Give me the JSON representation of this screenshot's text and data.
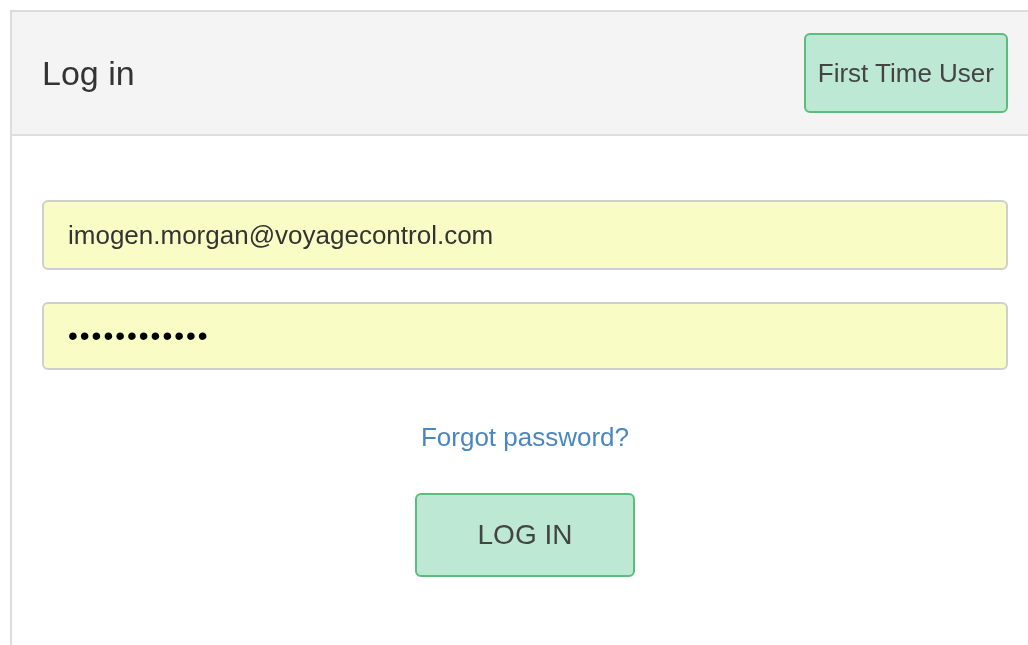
{
  "header": {
    "title": "Log in",
    "first_time_button": "First Time User"
  },
  "email_field": {
    "value": "imogen.morgan@voyagecontrol.com"
  },
  "password_field": {
    "value": "••••••••••••"
  },
  "forgot_link": "Forgot password?",
  "login_button": "LOG IN"
}
